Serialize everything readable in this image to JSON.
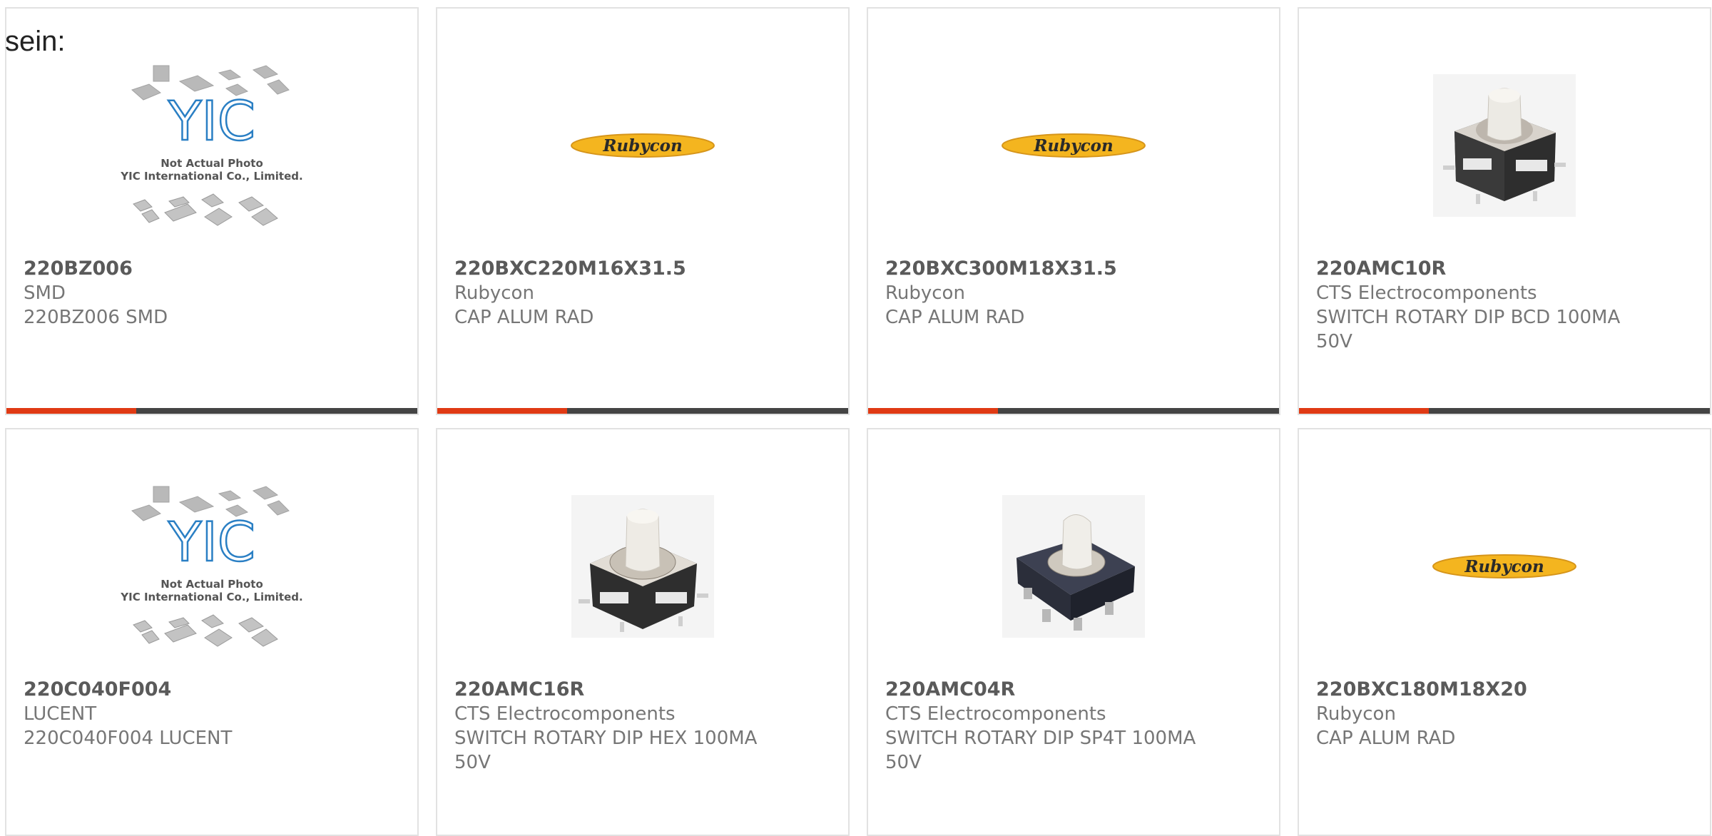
{
  "page": {
    "prefix_text": "sein:",
    "accent_color": "#e03a14",
    "bar_color": "#444444"
  },
  "cards": [
    {
      "part": "220BZ006",
      "maker": "SMD",
      "desc": "220BZ006 SMD",
      "image": "yic-placeholder-icon",
      "image_text": [
        "YIC",
        "Not Actual Photo",
        "YIC International Co., Limited."
      ]
    },
    {
      "part": "220BXC220M16X31.5",
      "maker": "Rubycon",
      "desc": "CAP ALUM RAD",
      "image": "rubycon-logo-icon",
      "image_text": [
        "Rubycon"
      ]
    },
    {
      "part": "220BXC300M18X31.5",
      "maker": "Rubycon",
      "desc": "CAP ALUM RAD",
      "image": "rubycon-logo-icon",
      "image_text": [
        "Rubycon"
      ]
    },
    {
      "part": "220AMC10R",
      "maker": "CTS Electrocomponents",
      "desc": "SWITCH ROTARY DIP BCD 100MA 50V",
      "image": "rotary-switch-icon"
    },
    {
      "part": "220C040F004",
      "maker": "LUCENT",
      "desc": "220C040F004 LUCENT",
      "image": "yic-placeholder-icon",
      "image_text": [
        "YIC",
        "Not Actual Photo",
        "YIC International Co., Limited."
      ]
    },
    {
      "part": "220AMC16R",
      "maker": "CTS Electrocomponents",
      "desc": "SWITCH ROTARY DIP HEX 100MA 50V",
      "image": "rotary-switch-icon"
    },
    {
      "part": "220AMC04R",
      "maker": "CTS Electrocomponents",
      "desc": "SWITCH ROTARY DIP SP4T 100MA 50V",
      "image": "rotary-switch-dark-icon"
    },
    {
      "part": "220BXC180M18X20",
      "maker": "Rubycon",
      "desc": "CAP ALUM RAD",
      "image": "rubycon-logo-icon",
      "image_text": [
        "Rubycon"
      ]
    }
  ]
}
